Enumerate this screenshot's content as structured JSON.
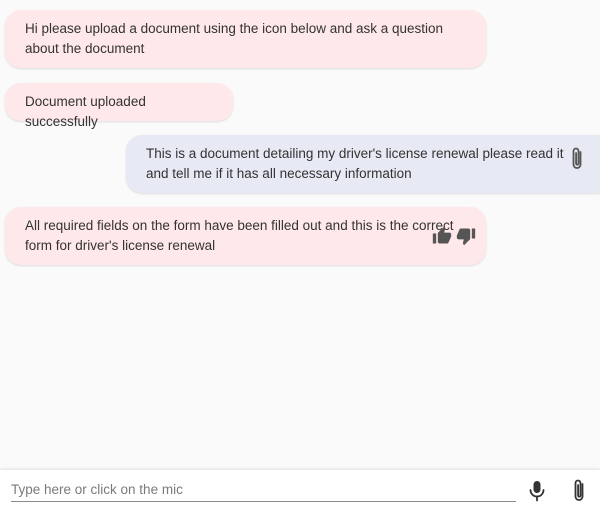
{
  "chat": {
    "messages": [
      {
        "sender": "bot",
        "text": "Hi please upload a document using the icon below and ask a question about the document"
      },
      {
        "sender": "bot",
        "text": "Document uploaded successfully"
      },
      {
        "sender": "user",
        "text": "This is a document detailing my driver's license renewal please read it and tell me if it has all necessary information",
        "icon": "paperclip-icon"
      },
      {
        "sender": "bot",
        "text": "All required fields on the form have been filled out and this is the correct form for driver's license renewal",
        "actions": [
          "thumbs-up-icon",
          "thumbs-down-icon"
        ]
      }
    ]
  },
  "input": {
    "placeholder": "Type here or click on the mic",
    "value": ""
  },
  "icons": {
    "mic": "microphone-icon",
    "attach": "paperclip-icon"
  },
  "colors": {
    "bot_bubble": "#ffe8ea",
    "user_bubble": "#e7e9f4",
    "background": "#fafafa",
    "icon": "#555555"
  }
}
